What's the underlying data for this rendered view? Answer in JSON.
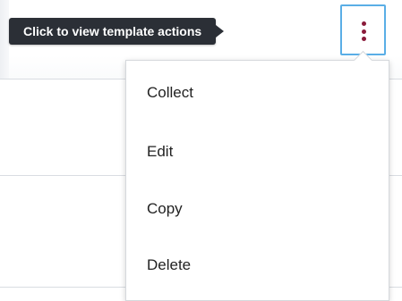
{
  "tooltip": {
    "text": "Click to view template actions"
  },
  "actions_button": {
    "icon": "kebab-vertical-icon",
    "dot_color": "#8a1b3a",
    "border_color": "#5aaee6"
  },
  "menu": {
    "items": [
      {
        "label": "Collect"
      },
      {
        "label": "Edit"
      },
      {
        "label": "Copy"
      },
      {
        "label": "Delete"
      }
    ]
  },
  "colors": {
    "tooltip_bg": "#2b2f36",
    "menu_text": "#222222",
    "divider": "#d9dde2"
  }
}
